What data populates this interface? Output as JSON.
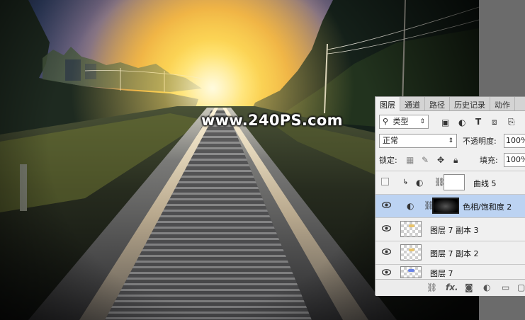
{
  "watermark": "www.240PS.com",
  "panel": {
    "tabs": [
      "图层",
      "通道",
      "路径",
      "历史记录",
      "动作"
    ],
    "active_tab": "图层",
    "filter": {
      "value": "类型"
    },
    "blend": {
      "value": "正常",
      "opacity_label": "不透明度:",
      "opacity_value": "100%"
    },
    "lock": {
      "label": "锁定:",
      "fill_label": "填充:",
      "fill_value": "100%"
    },
    "layers": [
      {
        "name": "曲线 5",
        "visible": false,
        "type": "curves"
      },
      {
        "name": "色相/饱和度 2",
        "visible": true,
        "type": "hue-saturation",
        "selected": true
      },
      {
        "name": "图层 7 副本 3",
        "visible": true,
        "type": "pixel"
      },
      {
        "name": "图层 7 副本 2",
        "visible": true,
        "type": "pixel"
      },
      {
        "name": "图层 7",
        "visible": true,
        "type": "pixel"
      }
    ],
    "footer_fx": "fx."
  },
  "colors": {
    "panel_bg": "#f0f0f0",
    "selected_layer": "#bcd3f2",
    "sky_glow": "#ffd23a"
  }
}
